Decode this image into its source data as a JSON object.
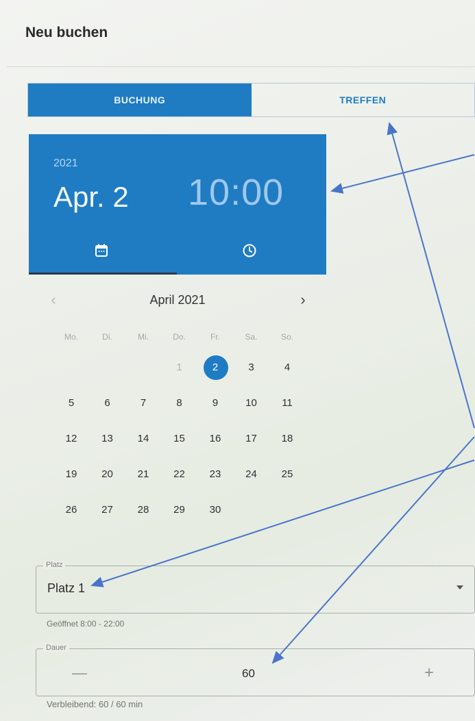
{
  "header": {
    "title": "Neu buchen"
  },
  "tabs": [
    {
      "label": "BUCHUNG",
      "active": true
    },
    {
      "label": "TREFFEN",
      "active": false
    }
  ],
  "picker": {
    "year": "2021",
    "date": "Apr. 2",
    "time": "10:00",
    "icons": [
      "calendar-icon",
      "clock-icon"
    ]
  },
  "calendar": {
    "month_label": "April 2021",
    "weekdays": [
      "Mo.",
      "Di.",
      "Mi.",
      "Do.",
      "Fr.",
      "Sa.",
      "So."
    ],
    "first_weekday_index": 3,
    "days_in_month": 30,
    "selected_day": 2
  },
  "platz": {
    "legend": "Platz",
    "value": "Platz 1",
    "hint": "Geöffnet 8:00 - 22:00"
  },
  "dauer": {
    "legend": "Dauer",
    "minus": "—",
    "value": "60",
    "plus": "+",
    "hint": "Verbleibend: 60 / 60 min"
  },
  "colors": {
    "accent": "#1f7cc3",
    "annotation": "#4a74c9"
  }
}
